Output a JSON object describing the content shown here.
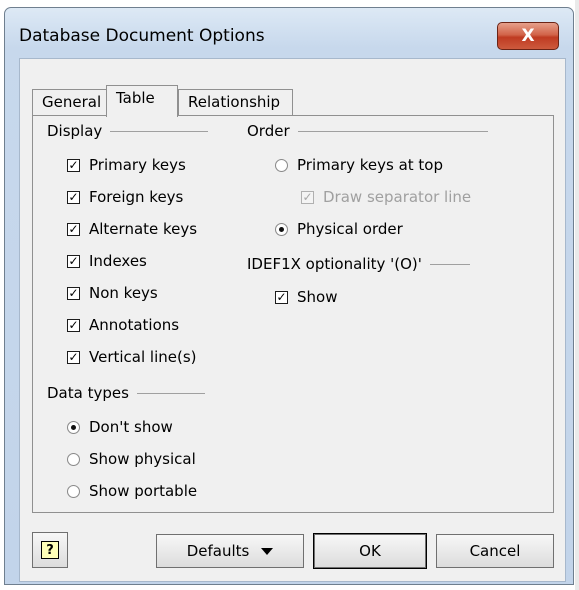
{
  "window": {
    "title": "Database Document Options",
    "close_glyph": "X"
  },
  "tabs": [
    {
      "label": "General",
      "active": false
    },
    {
      "label": "Table",
      "active": true
    },
    {
      "label": "Relationship",
      "active": false
    }
  ],
  "display": {
    "title": "Display",
    "items": [
      {
        "label": "Primary keys",
        "checked": true
      },
      {
        "label": "Foreign keys",
        "checked": true
      },
      {
        "label": "Alternate keys",
        "checked": true
      },
      {
        "label": "Indexes",
        "checked": true
      },
      {
        "label": "Non keys",
        "checked": true
      },
      {
        "label": "Annotations",
        "checked": true
      },
      {
        "label": "Vertical line(s)",
        "checked": true
      }
    ]
  },
  "data_types": {
    "title": "Data types",
    "options": [
      {
        "label": "Don't show",
        "selected": true
      },
      {
        "label": "Show physical",
        "selected": false
      },
      {
        "label": "Show portable",
        "selected": false
      }
    ]
  },
  "order": {
    "title": "Order",
    "primary_keys_at_top": "Primary keys at top",
    "draw_separator_line": "Draw separator line",
    "physical_order": "Physical order"
  },
  "idef1x": {
    "title": "IDEF1X optionality '(O)'",
    "show_label": "Show"
  },
  "buttons": {
    "help_glyph": "?",
    "defaults": "Defaults",
    "ok": "OK",
    "cancel": "Cancel"
  },
  "check_glyph": "✓"
}
